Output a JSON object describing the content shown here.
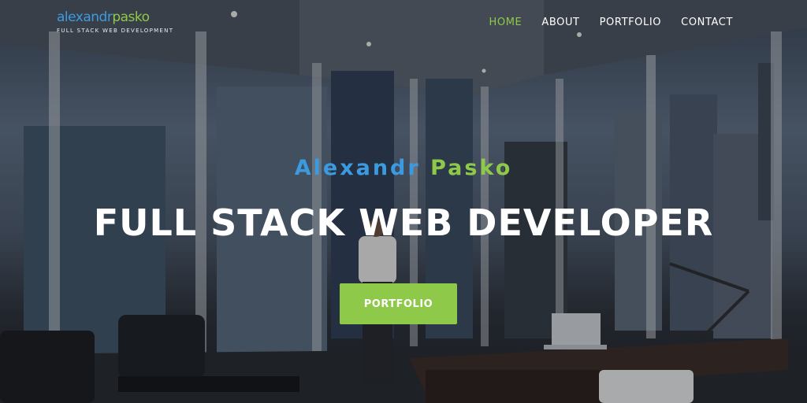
{
  "brand": {
    "logo_part1": "alexandr",
    "logo_part2": "pasko",
    "tagline": "FULL STACK WEB DEVELOPMENT"
  },
  "nav": {
    "items": [
      {
        "label": "HOME",
        "active": true
      },
      {
        "label": "ABOUT",
        "active": false
      },
      {
        "label": "PORTFOLIO",
        "active": false
      },
      {
        "label": "CONTACT",
        "active": false
      }
    ]
  },
  "hero": {
    "name_first": "Alexandr",
    "name_last": "Pasko",
    "headline": "FULL STACK WEB DEVELOPER",
    "cta_label": "PORTFOLIO"
  },
  "colors": {
    "accent_green": "#8fc94a",
    "accent_blue": "#3c9be0"
  }
}
